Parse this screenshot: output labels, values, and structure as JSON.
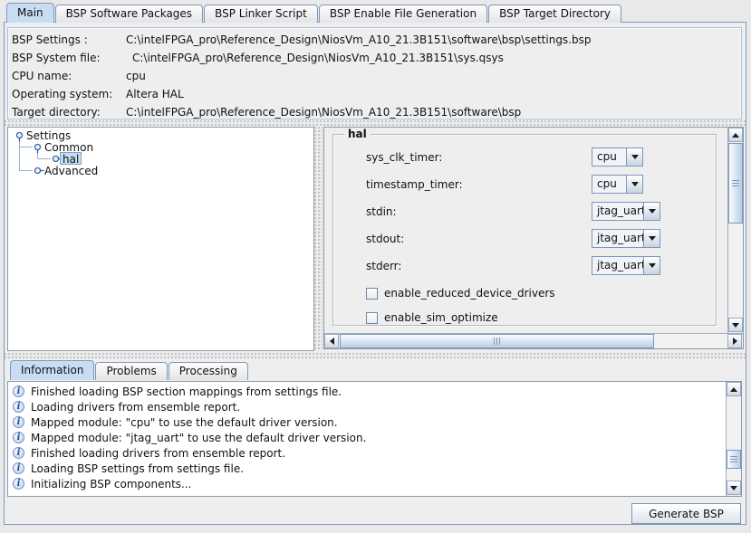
{
  "main_tabs": {
    "selected": "Main",
    "items": [
      {
        "label": "Main"
      },
      {
        "label": "BSP Software Packages"
      },
      {
        "label": "BSP Linker Script"
      },
      {
        "label": "BSP Enable File Generation"
      },
      {
        "label": "BSP Target Directory"
      }
    ]
  },
  "info_panel": {
    "rows": [
      {
        "label": "BSP Settings :",
        "value": "C:\\intelFPGA_pro\\Reference_Design\\NiosVm_A10_21.3B151\\software\\bsp\\settings.bsp"
      },
      {
        "label": "BSP System file:",
        "value": "C:\\intelFPGA_pro\\Reference_Design\\NiosVm_A10_21.3B151\\sys.qsys"
      },
      {
        "label": "CPU name:",
        "value": "cpu"
      },
      {
        "label": "Operating system:",
        "value": "Altera HAL"
      },
      {
        "label": "Target directory:",
        "value": "C:\\intelFPGA_pro\\Reference_Design\\NiosVm_A10_21.3B151\\software\\bsp"
      }
    ]
  },
  "tree": {
    "selected": "hal",
    "items": [
      {
        "label": "Settings",
        "state": "expanded"
      },
      {
        "label": "Common",
        "state": "expanded"
      },
      {
        "label": "hal",
        "state": "collapsed",
        "selected": true
      },
      {
        "label": "Advanced",
        "state": "collapsed"
      }
    ]
  },
  "settings_form": {
    "group_title": "hal",
    "fields": [
      {
        "label": "sys_clk_timer:",
        "value": "cpu"
      },
      {
        "label": "timestamp_timer:",
        "value": "cpu"
      },
      {
        "label": "stdin:",
        "value": "jtag_uart"
      },
      {
        "label": "stdout:",
        "value": "jtag_uart"
      },
      {
        "label": "stderr:",
        "value": "jtag_uart"
      }
    ],
    "checkboxes": [
      {
        "label": "enable_reduced_device_drivers",
        "checked": false
      },
      {
        "label": "enable_sim_optimize",
        "checked": false
      }
    ]
  },
  "console": {
    "selected": "Information",
    "tabs": [
      {
        "label": "Information"
      },
      {
        "label": "Problems"
      },
      {
        "label": "Processing"
      }
    ],
    "messages": [
      {
        "text": "Finished loading BSP section mappings from settings file."
      },
      {
        "text": "Loading drivers from ensemble report."
      },
      {
        "text": "Mapped module: \"cpu\" to use the default driver version."
      },
      {
        "text": "Mapped module: \"jtag_uart\" to use the default driver version."
      },
      {
        "text": "Finished loading drivers from ensemble report."
      },
      {
        "text": "Loading BSP settings from settings file."
      },
      {
        "text": "Initializing BSP components..."
      }
    ]
  },
  "actions": {
    "generate_label": "Generate BSP"
  },
  "icons": {
    "info_glyph": "i"
  },
  "colors": {
    "selection": "#c8ddf4",
    "accent": "#7e96b8",
    "info_icon": "#4a7ebb",
    "background": "#eeeeee"
  }
}
